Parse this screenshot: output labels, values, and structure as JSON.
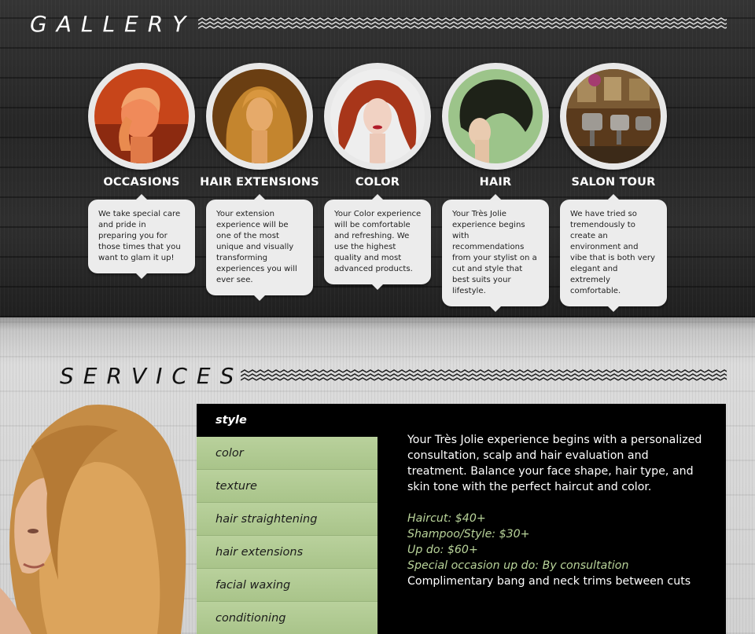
{
  "gallery": {
    "title": "GALLERY",
    "items": [
      {
        "label": "OCCASIONS",
        "text": "We take special care and pride in preparing you for those times that you want to glam it up!"
      },
      {
        "label": "HAIR EXTENSIONS",
        "text": "Your extension experience will be one of the most unique and visually transforming experiences you will ever see."
      },
      {
        "label": "COLOR",
        "text": "Your Color experience will be comfortable and refreshing. We use the highest quality and most advanced products."
      },
      {
        "label": "HAIR",
        "text": "Your Très Jolie experience begins with recommendations from your stylist on a cut and style that best suits your lifestyle."
      },
      {
        "label": "SALON TOUR",
        "text": "We have tried so tremendously to create an environment and vibe that is both very elegant and extremely comfortable."
      }
    ]
  },
  "services": {
    "title": "SERVICES",
    "menu": [
      "style",
      "color",
      "texture",
      "hair straightening",
      "hair extensions",
      "facial waxing",
      "conditioning"
    ],
    "active": "style",
    "description": "Your Très Jolie experience begins with a personalized consultation, scalp and hair evaluation and treatment. Balance your face shape, hair type, and skin tone with the perfect haircut and color.",
    "prices": [
      "Haircut: $40+",
      "Shampoo/Style: $30+",
      "Up do: $60+",
      "Special occasion up do: By consultation"
    ],
    "note": "Complimentary bang and neck trims between cuts"
  },
  "colors": {
    "accent_green": "#b9d49a",
    "menu_green": "#aec88f",
    "panel_black": "#000000"
  }
}
